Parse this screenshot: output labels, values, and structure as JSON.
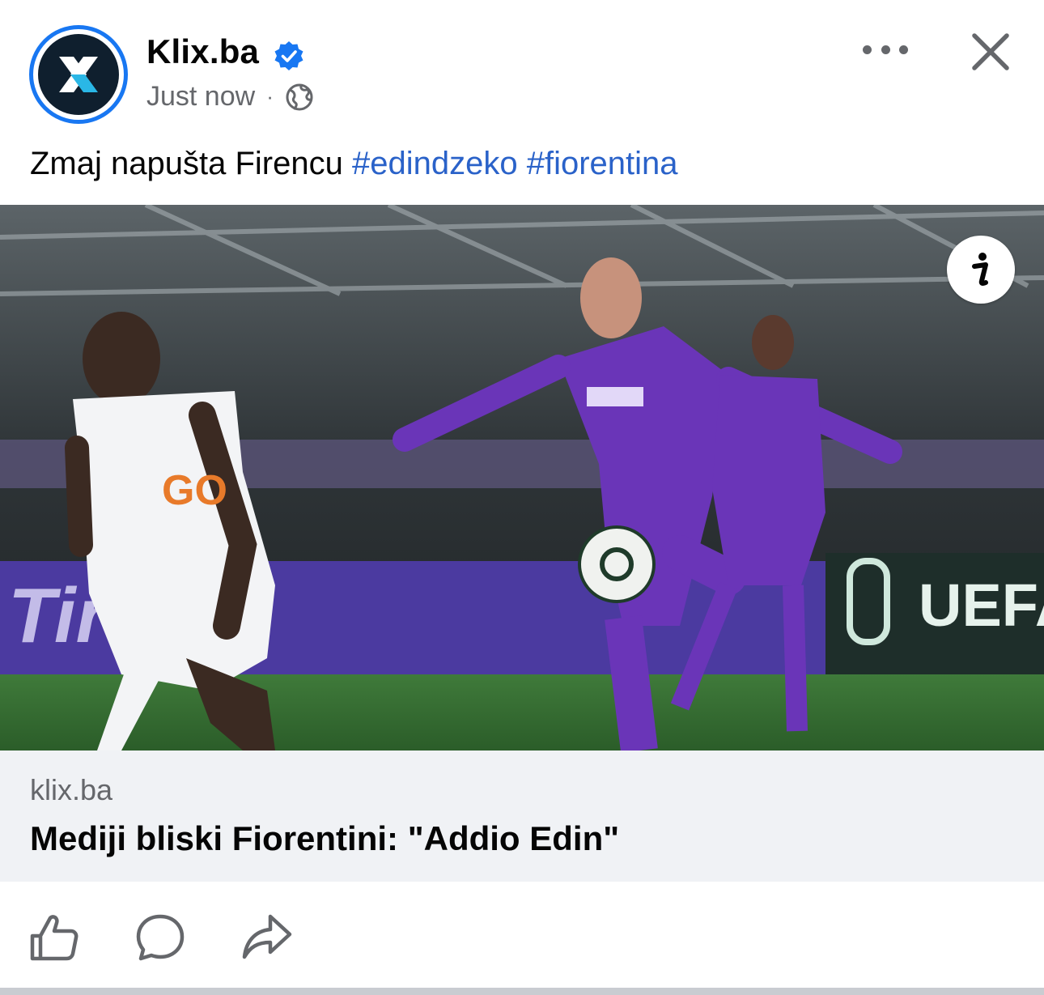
{
  "post": {
    "page_name": "Klix.ba",
    "timestamp": "Just now",
    "separator": "·",
    "text": "Zmaj napušta Firencu",
    "hashtags": [
      "#edindzeko",
      "#fiorentina"
    ],
    "link": {
      "domain": "klix.ba",
      "title": "Mediji bliski Fiorentini: \"Addio Edin\""
    }
  },
  "icons": {
    "verified": "verified-badge-icon",
    "audience": "globe-icon",
    "more": "more-options-icon",
    "close": "close-icon",
    "info": "info-icon",
    "like": "like-icon",
    "comment": "comment-icon",
    "share": "share-icon"
  },
  "colors": {
    "brand_blue": "#1877f2",
    "hashtag": "#2a62c9",
    "secondary_text": "#65676b",
    "link_box_bg": "#f0f2f5"
  }
}
